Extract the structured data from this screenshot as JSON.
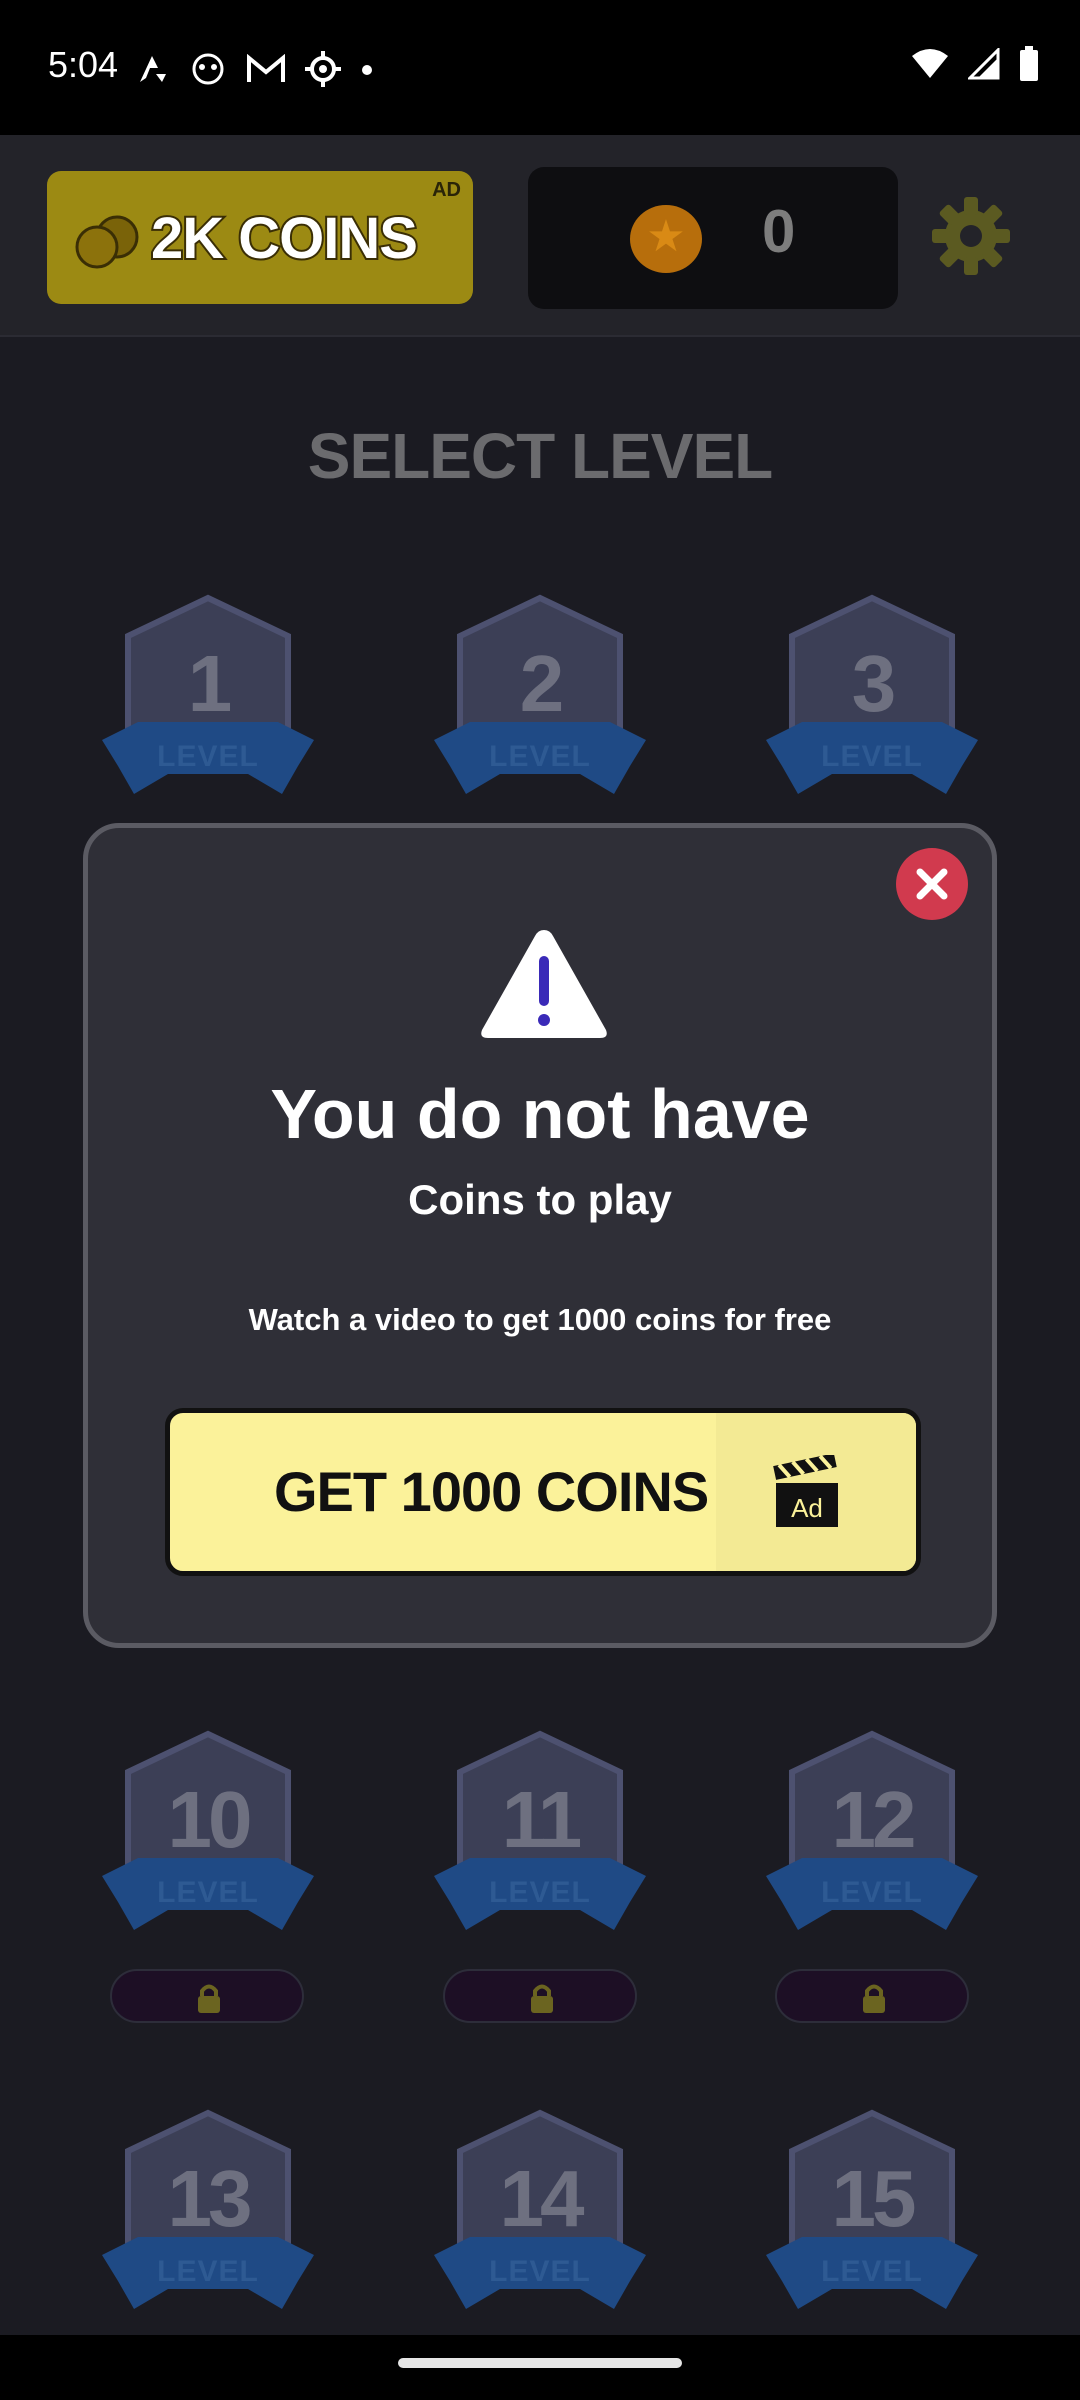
{
  "status_bar": {
    "time": "5:04"
  },
  "top_bar": {
    "ad_coins_label": "2K COINS",
    "ad_tag": "AD",
    "coin_balance": "0"
  },
  "screen_title": "SELECT LEVEL",
  "levels": [
    {
      "number": "1",
      "label": "LEVEL",
      "locked": false
    },
    {
      "number": "2",
      "label": "LEVEL",
      "locked": false
    },
    {
      "number": "3",
      "label": "LEVEL",
      "locked": false
    },
    {
      "number": "10",
      "label": "LEVEL",
      "locked": true
    },
    {
      "number": "11",
      "label": "LEVEL",
      "locked": true
    },
    {
      "number": "12",
      "label": "LEVEL",
      "locked": true
    },
    {
      "number": "13",
      "label": "LEVEL",
      "locked": false
    },
    {
      "number": "14",
      "label": "LEVEL",
      "locked": false
    },
    {
      "number": "15",
      "label": "LEVEL",
      "locked": false
    }
  ],
  "modal": {
    "heading": "You do not have",
    "subheading": "Coins to play",
    "description": "Watch a video to get 1000 coins for free",
    "button_label": "GET 1000 COINS",
    "button_icon_text": "Ad"
  },
  "colors": {
    "ad_coins_bg": "#9c8a13",
    "button_bg": "#fbf29a",
    "close_button": "#d13a4e",
    "ribbon": "#2e5a93"
  }
}
